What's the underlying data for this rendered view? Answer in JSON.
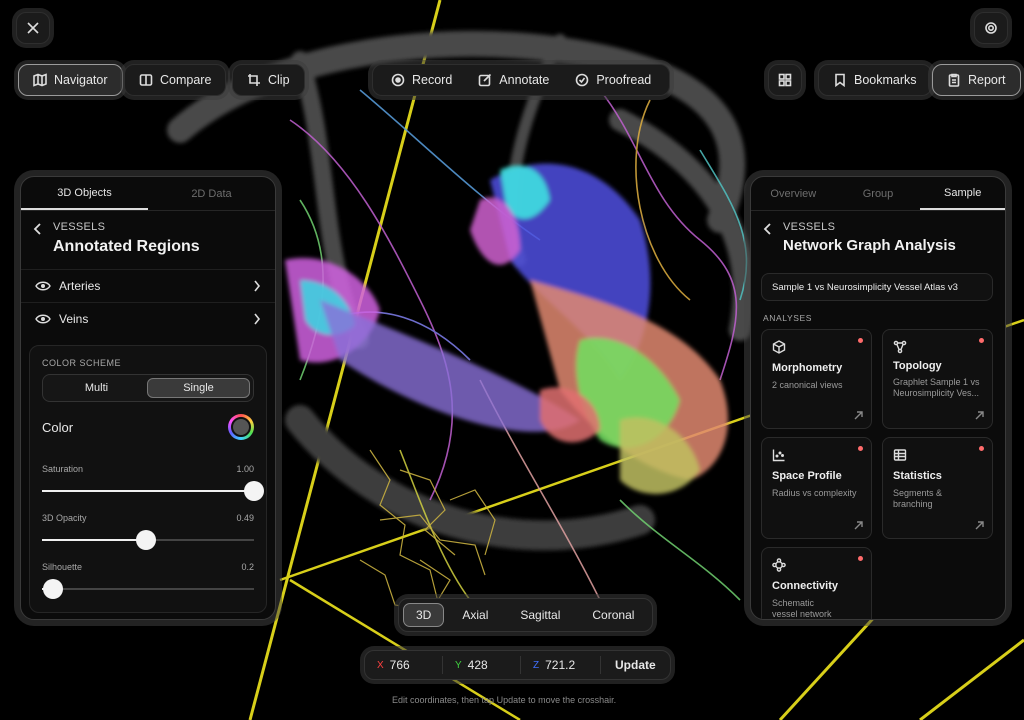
{
  "toolbar": {
    "navigator": "Navigator",
    "compare": "Compare",
    "clip": "Clip",
    "record": "Record",
    "annotate": "Annotate",
    "proofread": "Proofread",
    "bookmarks": "Bookmarks",
    "report": "Report"
  },
  "left_panel": {
    "tabs": [
      "3D Objects",
      "2D Data"
    ],
    "active_tab": "3D Objects",
    "crumb": "VESSELS",
    "title": "Annotated Regions",
    "items": [
      {
        "label": "Arteries"
      },
      {
        "label": "Veins"
      }
    ],
    "color_scheme_label": "COLOR SCHEME",
    "scheme_options": [
      "Multi",
      "Single"
    ],
    "scheme_selected": "Single",
    "color_label": "Color",
    "sliders": [
      {
        "label": "Saturation",
        "value_text": "1.00",
        "value": 1.0
      },
      {
        "label": "3D Opacity",
        "value_text": "0.49",
        "value": 0.49
      },
      {
        "label": "Silhouette",
        "value_text": "0.2",
        "value": 0.05
      }
    ]
  },
  "right_panel": {
    "tabs": [
      "Overview",
      "Group",
      "Sample"
    ],
    "active_tab": "Sample",
    "crumb": "VESSELS",
    "title": "Network Graph Analysis",
    "comparison": "Sample 1 vs Neurosimplicity Vessel Atlas v3",
    "analyses_label": "ANALYSES",
    "cards": [
      {
        "title": "Morphometry",
        "subtitle": "2 canonical views"
      },
      {
        "title": "Topology",
        "subtitle": "Graphlet Sample 1 vs Neurosimplicity Ves..."
      },
      {
        "title": "Space Profile",
        "subtitle": "Radius vs complexity"
      },
      {
        "title": "Statistics",
        "subtitle": "Segments & branching"
      },
      {
        "title": "Connectivity",
        "subtitle": "Schematic vessel network"
      }
    ]
  },
  "views": {
    "options": [
      "3D",
      "Axial",
      "Sagittal",
      "Coronal"
    ],
    "selected": "3D"
  },
  "coordinates": {
    "x_label": "X",
    "x": "766",
    "y_label": "Y",
    "y": "428",
    "z_label": "Z",
    "z": "721.2",
    "update": "Update",
    "hint": "Edit coordinates, then tap Update to move the crosshair."
  },
  "colors": {
    "accent_red": "#ff6b6b",
    "axis_x": "#ff4040",
    "axis_y": "#40d040",
    "axis_z": "#4070ff"
  }
}
